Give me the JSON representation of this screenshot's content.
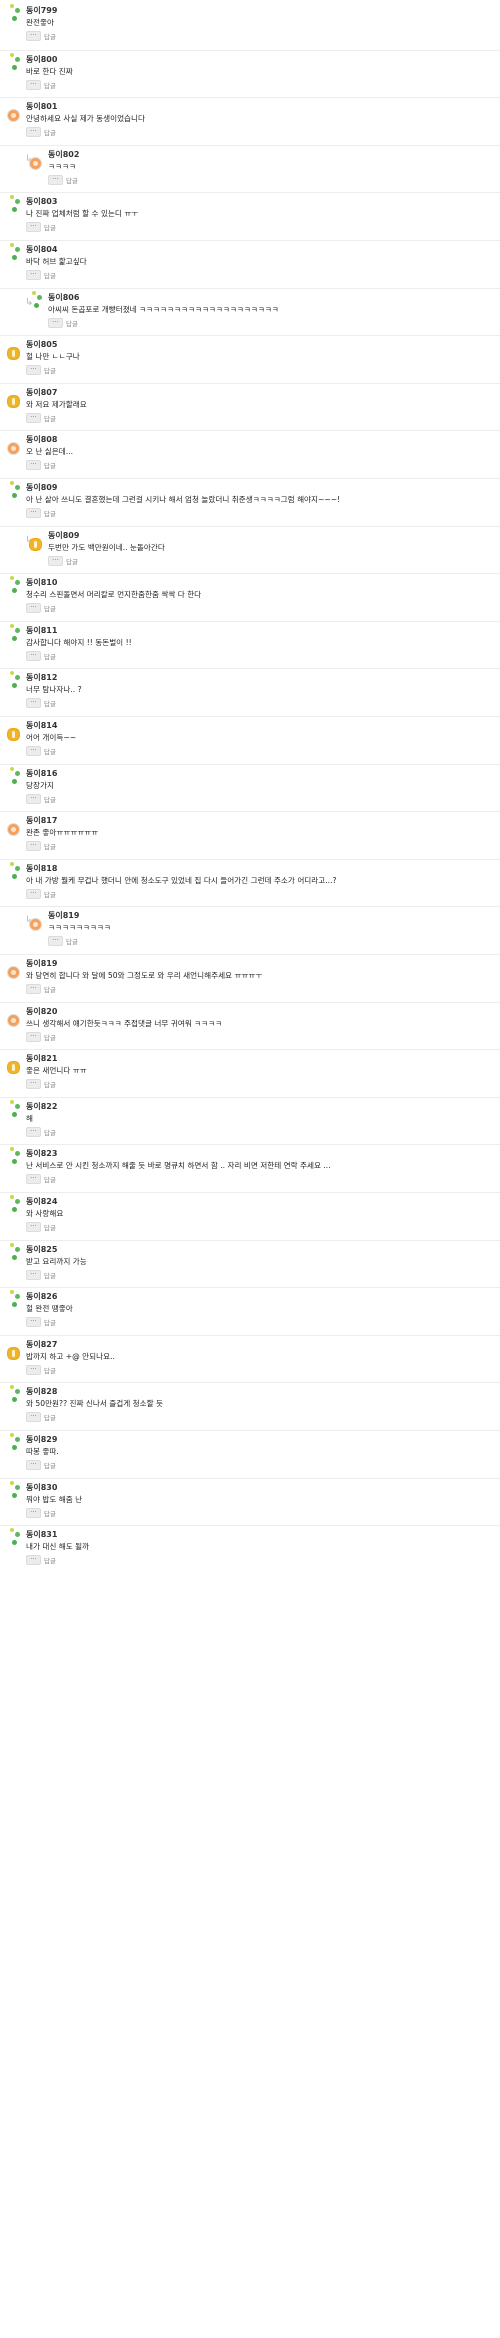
{
  "reply_action": "답글",
  "more_glyph": "···",
  "reply_marker": "↳",
  "comments": [
    {
      "author": "동이799",
      "text": "완전좋아",
      "avatar": "dots"
    },
    {
      "author": "동이800",
      "text": "바로 한다 진짜",
      "avatar": "dots"
    },
    {
      "author": "동이801",
      "text": "안녕하세요 사실 제가 동생이었습니다",
      "avatar": "orange"
    },
    {
      "author": "동이802",
      "text": "ㅋㅋㅋㅋ",
      "avatar": "orange",
      "reply": true
    },
    {
      "author": "동이803",
      "text": "나 진짜 업체처럼 할 수 있는디 ㅠㅜ",
      "avatar": "dots"
    },
    {
      "author": "동이804",
      "text": "바닥 허브 핥고싶다",
      "avatar": "dots"
    },
    {
      "author": "동이806",
      "text": "아씨씨 돈곱포로 개빵터졌네 ㅋㅋㅋㅋㅋㅋㅋㅋㅋㅋㅋㅋㅋㅋㅋㅋㅋㅋㅋㅋ",
      "avatar": "dots",
      "reply": true
    },
    {
      "author": "동이805",
      "text": "헐 나만 ㄴㄴ구나",
      "avatar": "gold"
    },
    {
      "author": "동이807",
      "text": "와 저요 제가할래요",
      "avatar": "gold"
    },
    {
      "author": "동이808",
      "text": "오 난 싫은데...",
      "avatar": "orange"
    },
    {
      "author": "동이809",
      "text": "아 난 살아 쓰니도 결혼했는데 그런걸 시키나 해서 엄청 놀랐더니 취준생ㅋㅋㅋㅋ그럼 해야지~~~!",
      "avatar": "dots"
    },
    {
      "author": "동이809",
      "text": "두번만 가도 백만원이네.. 눈돌아간다",
      "avatar": "gold",
      "reply": true
    },
    {
      "author": "동이810",
      "text": "청수리 스핀돌면서 머리칼로 먼지한줌한줌 싹싹 다 한다",
      "avatar": "dots"
    },
    {
      "author": "동이811",
      "text": "감사합니다 해야지 !! 동돈벌이 !!",
      "avatar": "dots"
    },
    {
      "author": "동이812",
      "text": "너무 탐나자나.. ?",
      "avatar": "dots"
    },
    {
      "author": "동이814",
      "text": "어어 개이득~~",
      "avatar": "gold"
    },
    {
      "author": "동이816",
      "text": "당장가지",
      "avatar": "dots"
    },
    {
      "author": "동이817",
      "text": "완존 좋아ㅠㅠㅠㅠㅠㅠ",
      "avatar": "orange"
    },
    {
      "author": "동이818",
      "text": "아 내 가방 뭘케 무겁나 했더니 안에 청소도구 있었네 집 다시 들어가긴 그런데 주소가 어디라고...?",
      "avatar": "dots"
    },
    {
      "author": "동이819",
      "text": "ㅋㅋㅋㅋㅋㅋㅋㅋㅋ",
      "avatar": "orange",
      "reply": true
    },
    {
      "author": "동이819",
      "text": "와 당연히 합니다 와 달에 50와 그정도로 와 우리 새언니해주세요 ㅠㅠㅠㅜ",
      "avatar": "orange"
    },
    {
      "author": "동이820",
      "text": "쓰니 생각해서 얘기한듯ㅋㅋㅋ 주접댓글 너무 귀여워 ㅋㅋㅋㅋ",
      "avatar": "orange"
    },
    {
      "author": "동이821",
      "text": "좋은 새언니다 ㅠㅠ",
      "avatar": "gold"
    },
    {
      "author": "동이822",
      "text": "해",
      "avatar": "dots"
    },
    {
      "author": "동이823",
      "text": "난 서비스로 안 시킨 청소까지 해줄 듯 바로 명큐치 하면서 함 .. 자리 비면 저한테 연락 주세요 ...",
      "avatar": "dots"
    },
    {
      "author": "동이824",
      "text": "와 사랑해요",
      "avatar": "dots"
    },
    {
      "author": "동이825",
      "text": "받고 요리까지 가능",
      "avatar": "dots"
    },
    {
      "author": "동이826",
      "text": "헐 완전 땡좋아",
      "avatar": "dots"
    },
    {
      "author": "동이827",
      "text": "밥까지 하고 +@ 안되나요..",
      "avatar": "gold"
    },
    {
      "author": "동이828",
      "text": "와 50만원?? 진짜 신나서 즐겁게 청소할 듯",
      "avatar": "dots"
    },
    {
      "author": "동이829",
      "text": "따봉 좋따.",
      "avatar": "dots"
    },
    {
      "author": "동이830",
      "text": "뭐야 밥도 해줌 난",
      "avatar": "dots"
    },
    {
      "author": "동이831",
      "text": "내가 대신 해도 될까",
      "avatar": "dots"
    }
  ]
}
